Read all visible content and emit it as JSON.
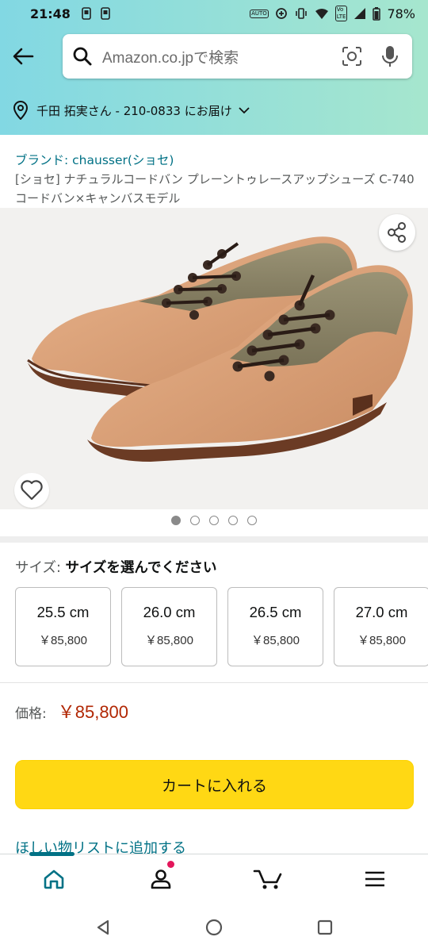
{
  "status_bar": {
    "time": "21:48",
    "battery": "78%"
  },
  "search": {
    "placeholder": "Amazon.co.jpで検索"
  },
  "delivery": {
    "text": "千田 拓実さん - 210-0833 にお届け"
  },
  "product": {
    "brand": "ブランド: chausser(ショセ)",
    "title": "[ショセ] ナチュラルコードバン プレーントゥレースアップシューズ C-740 コードバン×キャンバスモデル",
    "image_alt": "brown leather and canvas plain-toe lace-up shoes",
    "image_count": 5,
    "image_index": 1
  },
  "size_selector": {
    "label": "サイズ:",
    "value": "サイズを選んでください",
    "options": [
      {
        "size": "25.5 cm",
        "price": "￥85,800"
      },
      {
        "size": "26.0 cm",
        "price": "￥85,800"
      },
      {
        "size": "26.5 cm",
        "price": "￥85,800"
      },
      {
        "size": "27.0 cm",
        "price": "￥85,800"
      }
    ]
  },
  "price": {
    "label": "価格:",
    "value": "￥85,800"
  },
  "actions": {
    "add_to_cart": "カートに入れる",
    "add_to_wishlist": "ほしい物リストに追加する"
  },
  "bottom_nav": [
    "home-icon",
    "account-icon",
    "cart-icon",
    "menu-icon"
  ],
  "colors": {
    "accent": "#007185",
    "price": "#B12704",
    "cart_button": "#FFD814",
    "header_left": "#82D8E3",
    "header_right": "#A6E6CE"
  }
}
